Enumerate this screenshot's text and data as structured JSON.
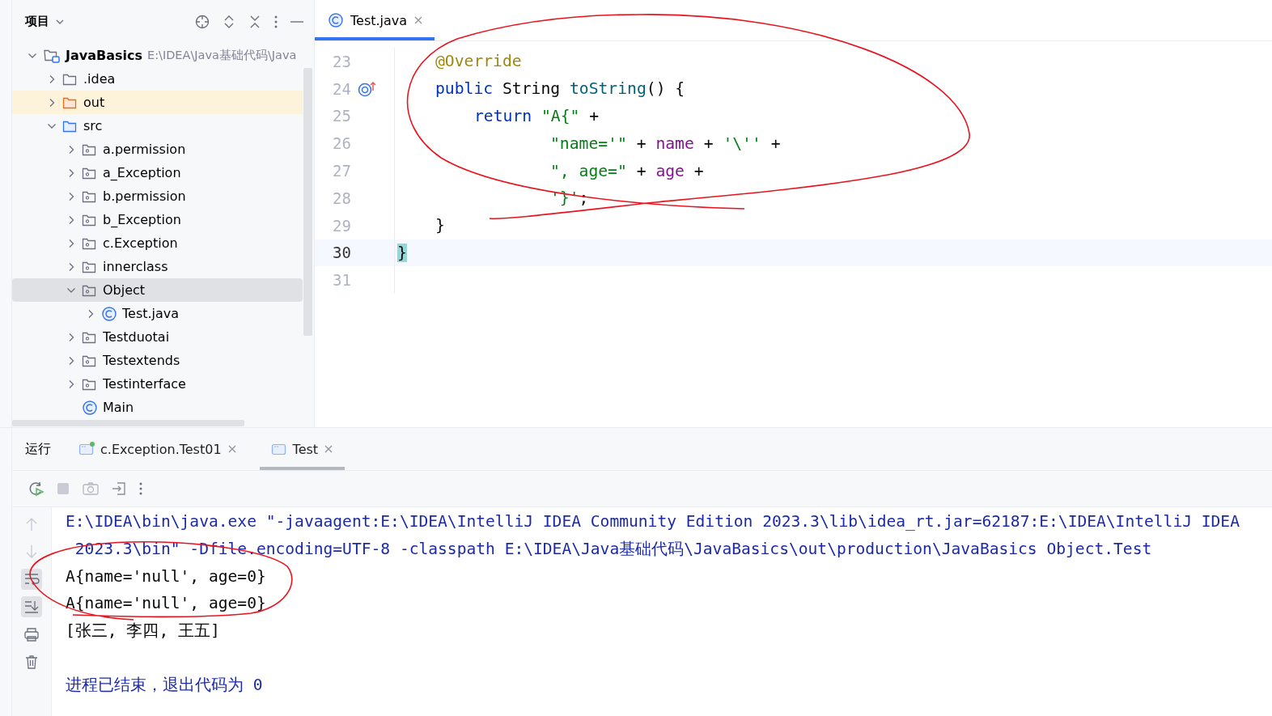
{
  "project_panel": {
    "title": "项目",
    "tree": [
      {
        "kind": "project",
        "label": "JavaBasics",
        "path": "E:\\IDEA\\Java基础代码\\Java",
        "expanded": true,
        "selected": false,
        "children": [
          {
            "kind": "folder",
            "label": ".idea",
            "expanded": false,
            "selected": false
          },
          {
            "kind": "excluded-folder",
            "label": "out",
            "expanded": false,
            "selected": false
          },
          {
            "kind": "source-folder",
            "label": "src",
            "expanded": true,
            "selected": false,
            "children": [
              {
                "kind": "package",
                "label": "a.permission",
                "expanded": false,
                "selected": false
              },
              {
                "kind": "package",
                "label": "a_Exception",
                "expanded": false,
                "selected": false
              },
              {
                "kind": "package",
                "label": "b.permission",
                "expanded": false,
                "selected": false
              },
              {
                "kind": "package",
                "label": "b_Exception",
                "expanded": false,
                "selected": false
              },
              {
                "kind": "package",
                "label": "c.Exception",
                "expanded": false,
                "selected": false
              },
              {
                "kind": "package",
                "label": "innerclass",
                "expanded": false,
                "selected": false
              },
              {
                "kind": "package",
                "label": "Object",
                "expanded": true,
                "selected": true,
                "children": [
                  {
                    "kind": "class",
                    "label": "Test.java",
                    "expanded": false,
                    "selected": false
                  }
                ]
              },
              {
                "kind": "package",
                "label": "Testduotai",
                "expanded": false,
                "selected": false
              },
              {
                "kind": "package",
                "label": "Testextends",
                "expanded": false,
                "selected": false
              },
              {
                "kind": "package",
                "label": "Testinterface",
                "expanded": false,
                "selected": false
              },
              {
                "kind": "class-leaf",
                "label": "Main",
                "expanded": false,
                "selected": false
              }
            ]
          }
        ]
      }
    ]
  },
  "editor": {
    "tabs": [
      {
        "label": "Test.java",
        "selected": true
      }
    ],
    "lines": [
      {
        "number": "23",
        "current": false,
        "kind": "member",
        "tokens": [
          {
            "kind": "annotation",
            "text": "@Override"
          }
        ]
      },
      {
        "number": "24",
        "current": false,
        "overrides": true,
        "kind": "member",
        "tokens": [
          {
            "kind": "keyword",
            "text": "public"
          },
          {
            "kind": "plain",
            "text": " String "
          },
          {
            "kind": "method",
            "text": "toString"
          },
          {
            "kind": "plain",
            "text": "() {"
          }
        ]
      },
      {
        "number": "25",
        "current": false,
        "kind": "statement",
        "tokens": [
          {
            "kind": "keyword",
            "text": "return"
          },
          {
            "kind": "string",
            "text": " \"A{\""
          },
          {
            "kind": "plain",
            "text": " +"
          }
        ]
      },
      {
        "number": "26",
        "current": false,
        "kind": "continuation",
        "tokens": [
          {
            "kind": "string",
            "text": "\"name='\""
          },
          {
            "kind": "plain",
            "text": " + "
          },
          {
            "kind": "field",
            "text": "name"
          },
          {
            "kind": "plain",
            "text": " + "
          },
          {
            "kind": "string",
            "text": "'\\''"
          },
          {
            "kind": "plain",
            "text": " +"
          }
        ]
      },
      {
        "number": "27",
        "current": false,
        "kind": "continuation",
        "tokens": [
          {
            "kind": "string",
            "text": "\", age=\""
          },
          {
            "kind": "plain",
            "text": " + "
          },
          {
            "kind": "field",
            "text": "age"
          },
          {
            "kind": "plain",
            "text": " +"
          }
        ]
      },
      {
        "number": "28",
        "current": false,
        "kind": "continuation",
        "tokens": [
          {
            "kind": "string",
            "text": "'}'"
          },
          {
            "kind": "plain",
            "text": ";"
          }
        ]
      },
      {
        "number": "29",
        "current": false,
        "kind": "member",
        "tokens": [
          {
            "kind": "plain",
            "text": "}"
          }
        ]
      },
      {
        "number": "30",
        "current": true,
        "kind": "top-level",
        "tokens": [
          {
            "kind": "brace-match",
            "text": "}"
          }
        ]
      },
      {
        "number": "31",
        "current": false
      }
    ]
  },
  "run_panel": {
    "title": "运行",
    "tabs": [
      {
        "label": "c.Exception.Test01",
        "selected": false,
        "marked": true
      },
      {
        "label": "Test",
        "selected": true,
        "marked": false
      }
    ],
    "console": [
      {
        "kind": "command",
        "text": "E:\\IDEA\\bin\\java.exe \"-javaagent:E:\\IDEA\\IntelliJ IDEA Community Edition 2023.3\\lib\\idea_rt.jar=62187:E:\\IDEA\\IntelliJ IDEA"
      },
      {
        "kind": "command",
        "text": " 2023.3\\bin\" -Dfile.encoding=UTF-8 -classpath E:\\IDEA\\Java基础代码\\JavaBasics\\out\\production\\JavaBasics Object.Test"
      },
      {
        "kind": "output",
        "text": "A{name='null', age=0}"
      },
      {
        "kind": "output",
        "text": "A{name='null', age=0}"
      },
      {
        "kind": "output",
        "text": "[张三, 李四, 王五]"
      },
      {
        "kind": "blank"
      },
      {
        "kind": "command",
        "text": "进程已结束，退出代码为 0"
      }
    ]
  }
}
